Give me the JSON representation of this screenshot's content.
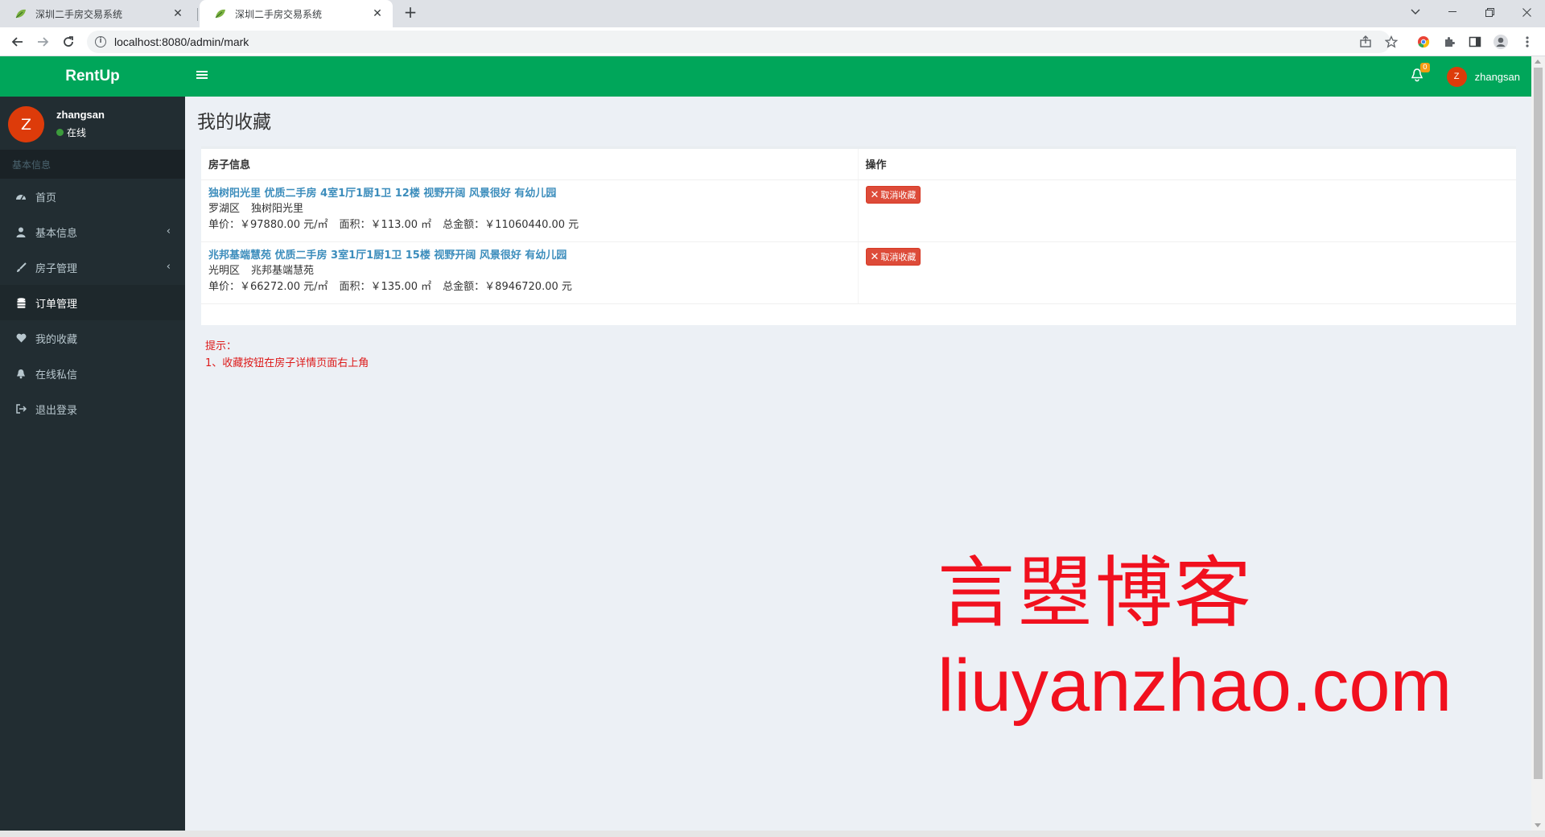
{
  "browser": {
    "tabs": [
      {
        "title": "深圳二手房交易系统",
        "active": false
      },
      {
        "title": "深圳二手房交易系统",
        "active": true
      }
    ],
    "url": "localhost:8080/admin/mark"
  },
  "app": {
    "brand": "RentUp",
    "accent_color": "#00a65a",
    "sidebar_bg": "#222d32"
  },
  "user": {
    "avatar_letter": "Z",
    "name": "zhangsan",
    "status": "在线"
  },
  "sidebar": {
    "header": "基本信息",
    "items": [
      {
        "label": "首页",
        "icon": "dashboard-icon",
        "has_children": false,
        "active": false
      },
      {
        "label": "基本信息",
        "icon": "user-icon",
        "has_children": true,
        "active": false
      },
      {
        "label": "房子管理",
        "icon": "brush-icon",
        "has_children": true,
        "active": false
      },
      {
        "label": "订单管理",
        "icon": "database-icon",
        "has_children": false,
        "active": true
      },
      {
        "label": "我的收藏",
        "icon": "heart-icon",
        "has_children": false,
        "active": false
      },
      {
        "label": "在线私信",
        "icon": "bell-icon",
        "has_children": false,
        "active": false
      },
      {
        "label": "退出登录",
        "icon": "sign-out-icon",
        "has_children": false,
        "active": false
      }
    ]
  },
  "topnav": {
    "notification_count": "0",
    "username": "zhangsan",
    "avatar_letter": "Z"
  },
  "page": {
    "title": "我的收藏",
    "table": {
      "columns": [
        "房子信息",
        "操作"
      ],
      "rows": [
        {
          "title": "独树阳光里 优质二手房 4室1厅1厨1卫 12楼 视野开阔 风景很好 有幼儿园",
          "district": "罗湖区",
          "community": "独树阳光里",
          "unit_price": "单价：￥97880.00 元/㎡",
          "area": "面积：￥113.00 ㎡",
          "total": "总金额：￥11060440.00 元",
          "action": "取消收藏"
        },
        {
          "title": "兆邦基端慧苑 优质二手房 3室1厅1厨1卫 15楼 视野开阔 风景很好 有幼儿园",
          "district": "光明区",
          "community": "兆邦基端慧苑",
          "unit_price": "单价：￥66272.00 元/㎡",
          "area": "面积：￥135.00 ㎡",
          "total": "总金额：￥8946720.00 元",
          "action": "取消收藏"
        }
      ]
    },
    "tips": {
      "label": "提示：",
      "lines": [
        "1、收藏按钮在房子详情页面右上角"
      ]
    }
  },
  "watermark": {
    "line1": "言曌博客",
    "line2": "liuyanzhao.com"
  }
}
